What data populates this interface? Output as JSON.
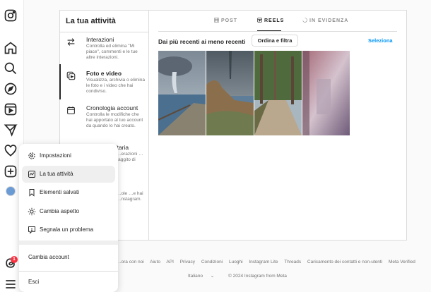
{
  "rail": {
    "icons": [
      "instagram-icon",
      "home-icon",
      "search-icon",
      "explore-icon",
      "reels-icon",
      "direct-icon",
      "heart-icon",
      "create-icon",
      "profile-avatar",
      "threads-icon",
      "menu-icon"
    ],
    "notification_count": "1"
  },
  "activity": {
    "title": "La tua attività",
    "items": [
      {
        "title": "Interazioni",
        "desc": "Controlla ed elimina \"Mi piace\", commenti e le tue altre interazioni.",
        "icon": "interactions-icon"
      },
      {
        "title": "Foto e video",
        "desc": "Visualizza, archivia o elimina le foto e i video che hai condiviso.",
        "icon": "photos-videos-icon"
      },
      {
        "title": "Cronologia account",
        "desc": "Controlla le modifiche che hai apportato al tuo account da quando lo hai creato.",
        "icon": "calendar-icon"
      },
      {
        "title": "…icitaria",
        "desc": "…erazioni …raggito di",
        "icon": "ads-icon"
      },
      {
        "title": "",
        "desc": "…ole …e hai …nstagram.",
        "icon": "links-icon"
      }
    ]
  },
  "tabs": [
    {
      "label": "POST",
      "icon": "grid-icon",
      "active": false
    },
    {
      "label": "REELS",
      "icon": "reels-icon",
      "active": true
    },
    {
      "label": "IN EVIDENZA",
      "icon": "highlights-icon",
      "active": false
    }
  ],
  "content": {
    "sort_label": "Dai più recenti ai meno recenti",
    "sort_button": "Ordina e filtra",
    "select_link": "Seleziona"
  },
  "footer": {
    "links": [
      "…ora con noi",
      "Aiuto",
      "API",
      "Privacy",
      "Condizioni",
      "Luoghi",
      "Instagram Lite",
      "Threads",
      "Caricamento dei contatti e non-utenti",
      "Meta Verified"
    ],
    "language": "Italiano",
    "copyright": "© 2024 Instagram from Meta"
  },
  "menu": {
    "items": [
      {
        "label": "Impostazioni",
        "icon": "gear-icon"
      },
      {
        "label": "La tua attività",
        "icon": "activity-icon"
      },
      {
        "label": "Elementi salvati",
        "icon": "bookmark-icon"
      },
      {
        "label": "Cambia aspetto",
        "icon": "sun-icon"
      },
      {
        "label": "Segnala un problema",
        "icon": "report-icon"
      }
    ],
    "switch_account": "Cambia account",
    "logout": "Esci"
  },
  "colors": {
    "link": "#0095f6",
    "badge": "#ff3040",
    "text": "#262626",
    "muted": "#737373"
  }
}
